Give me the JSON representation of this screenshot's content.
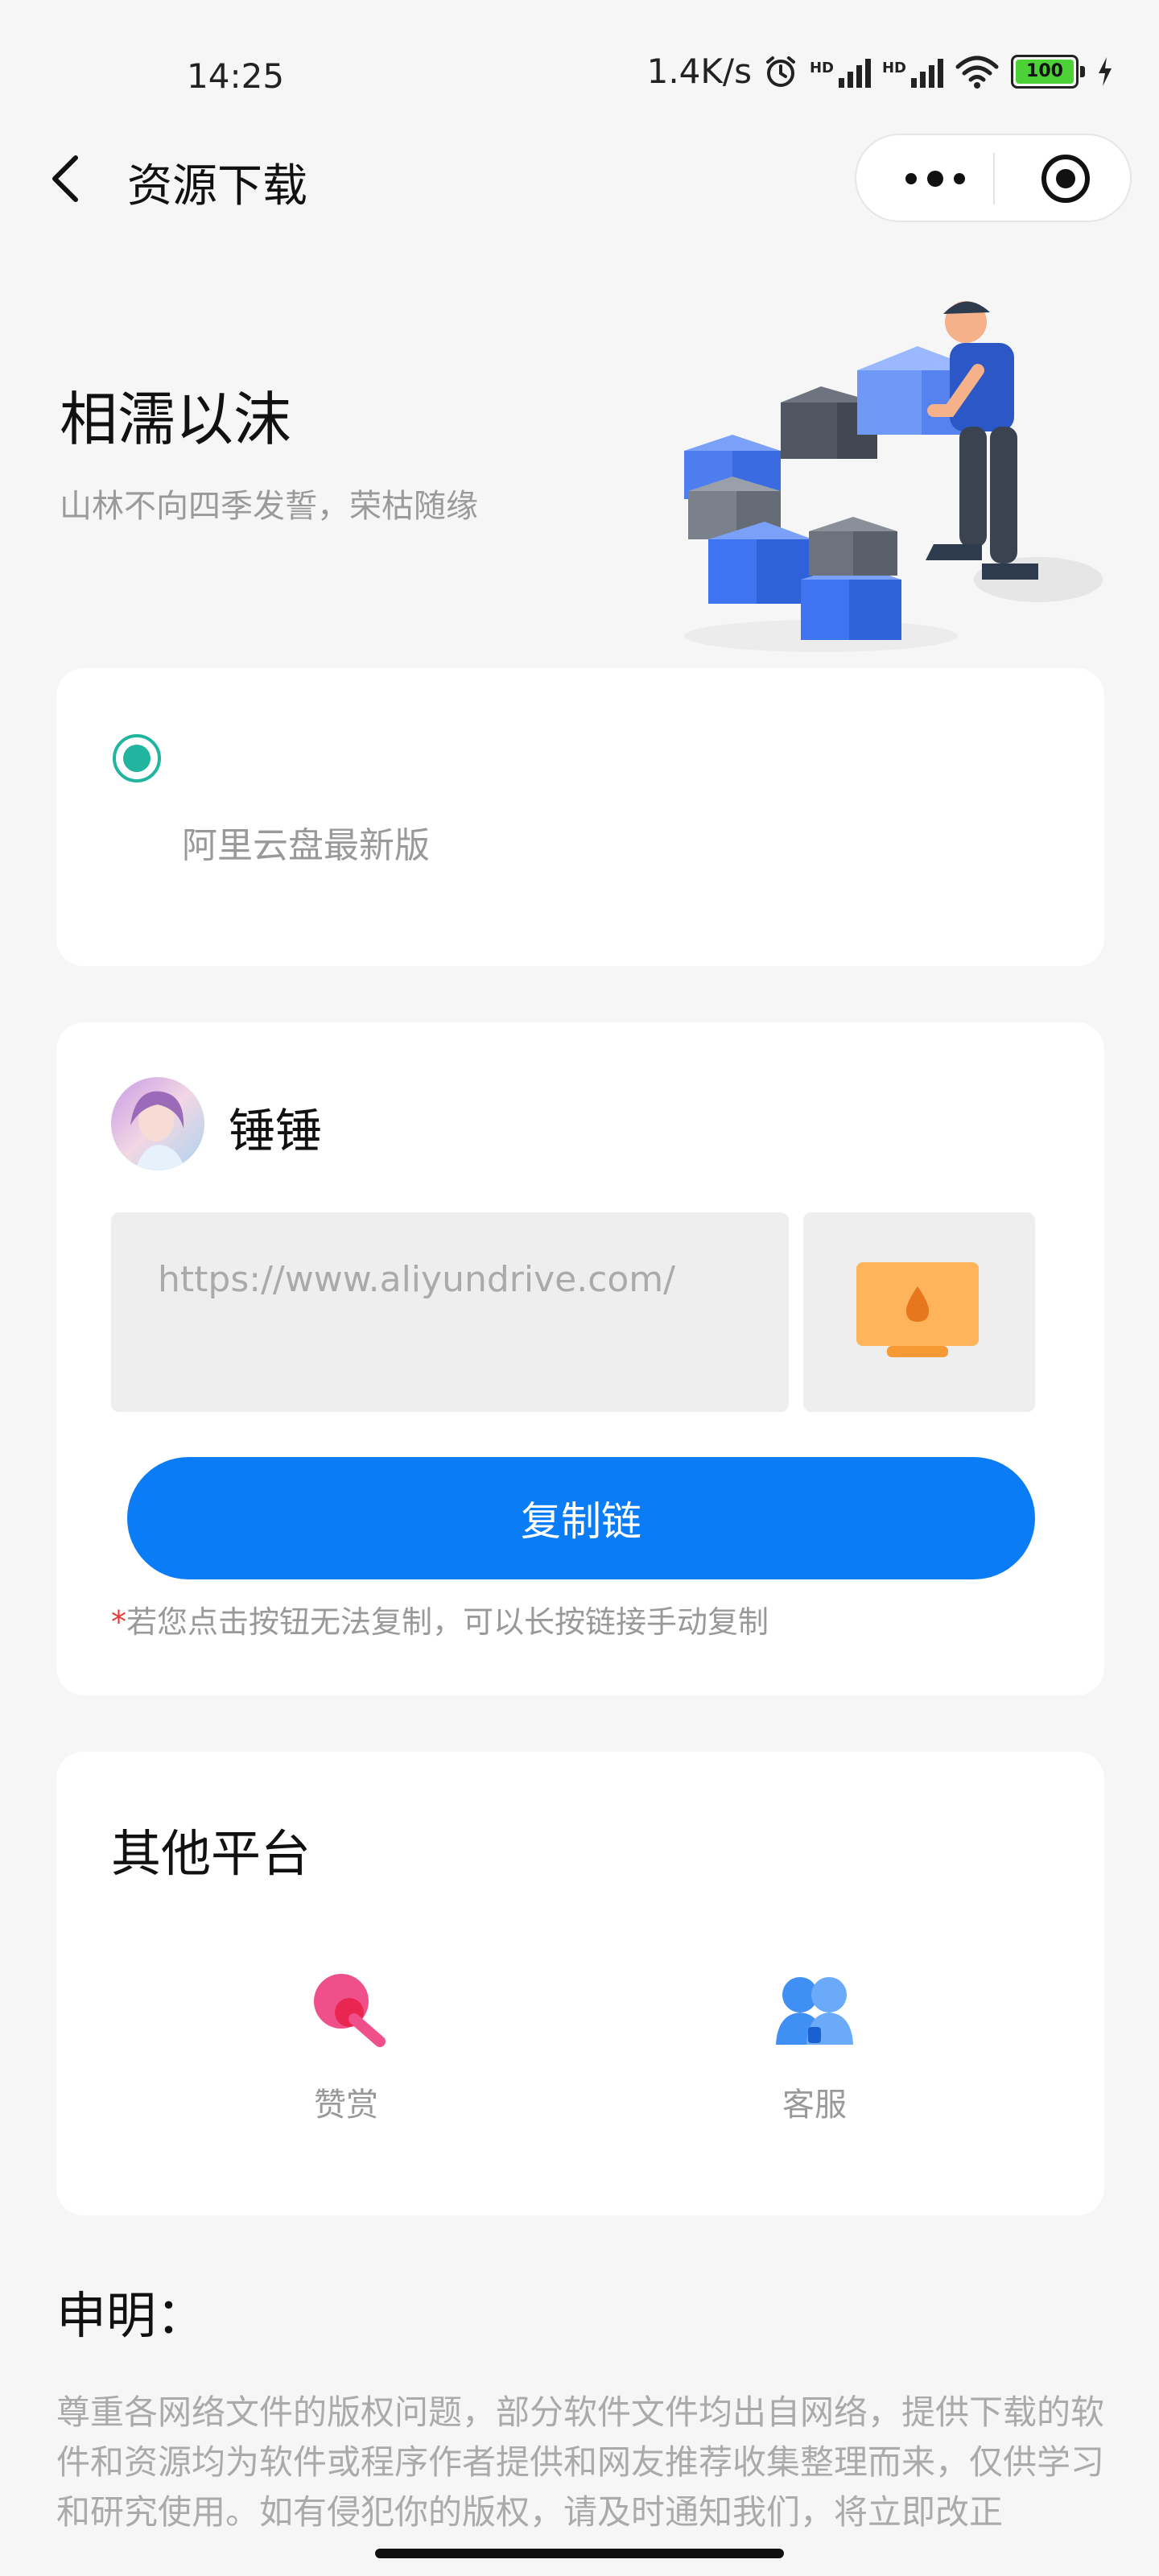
{
  "status_bar": {
    "time": "14:25",
    "speed": "1.4K/s",
    "hd1": "HD",
    "hd2": "HD",
    "battery": "100"
  },
  "nav": {
    "title": "资源下载"
  },
  "hero": {
    "title": "相濡以沫",
    "subtitle": "山林不向四季发誓，荣枯随缘"
  },
  "option": {
    "label": "阿里云盘最新版",
    "selected": true
  },
  "share": {
    "author": "锤锤",
    "link": "https://www.aliyundrive.com/",
    "copy_button": "复制链",
    "tip_star": "*",
    "tip": "若您点击按钮无法复制，可以长按链接手动复制"
  },
  "other": {
    "title": "其他平台",
    "items": [
      {
        "label": "赞赏",
        "icon": "lollipop-icon"
      },
      {
        "label": "客服",
        "icon": "customer-service-icon"
      }
    ]
  },
  "statement": {
    "title": "申明：",
    "body": "尊重各网络文件的版权问题，部分软件文件均出自网络，提供下载的软件和资源均为软件或程序作者提供和网友推荐收集整理而来，仅供学习和研究使用。如有侵犯你的版权，请及时通知我们，将立即改正"
  },
  "colors": {
    "accent": "#0a7cf5",
    "radio": "#21b5a0",
    "tip_star": "#e53935"
  }
}
